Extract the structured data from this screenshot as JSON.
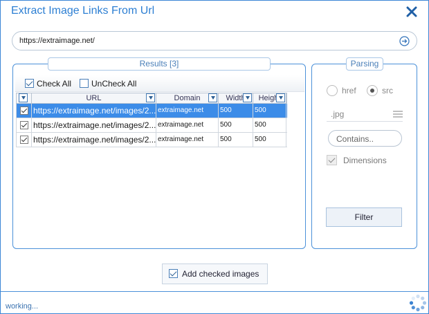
{
  "window": {
    "title": "Extract Image Links From Url",
    "accent_color": "#2d7fd3",
    "close_icon": "close-icon"
  },
  "url_bar": {
    "value": "https://extraimage.net/",
    "go_icon": "arrow-right-circle-icon"
  },
  "results": {
    "legend": "Results [3]",
    "check_all_label": "Check All",
    "uncheck_all_label": "UnCheck All",
    "columns": [
      "URL",
      "Domain",
      "Width",
      "Height"
    ],
    "rows": [
      {
        "checked": true,
        "selected": true,
        "url": "https://extraimage.net/images/2...",
        "domain": "extraimage.net",
        "width": "500",
        "height": "500"
      },
      {
        "checked": true,
        "selected": false,
        "url": "https://extraimage.net/images/2...",
        "domain": "extraimage.net",
        "width": "500",
        "height": "500"
      },
      {
        "checked": true,
        "selected": false,
        "url": "https://extraimage.net/images/2...",
        "domain": "extraimage.net",
        "width": "500",
        "height": "500"
      }
    ],
    "selected_row_color": "#3c8ce8"
  },
  "parsing": {
    "legend": "Parsing",
    "href_label": "href",
    "src_label": "src",
    "selected_mode": "src",
    "extension": ".jpg",
    "contains_placeholder": "Contains..",
    "dimensions_label": "Dimensions",
    "dimensions_checked": true,
    "filter_label": "Filter"
  },
  "actions": {
    "add_checked_label": "Add checked images"
  },
  "status": {
    "text": "working..."
  }
}
